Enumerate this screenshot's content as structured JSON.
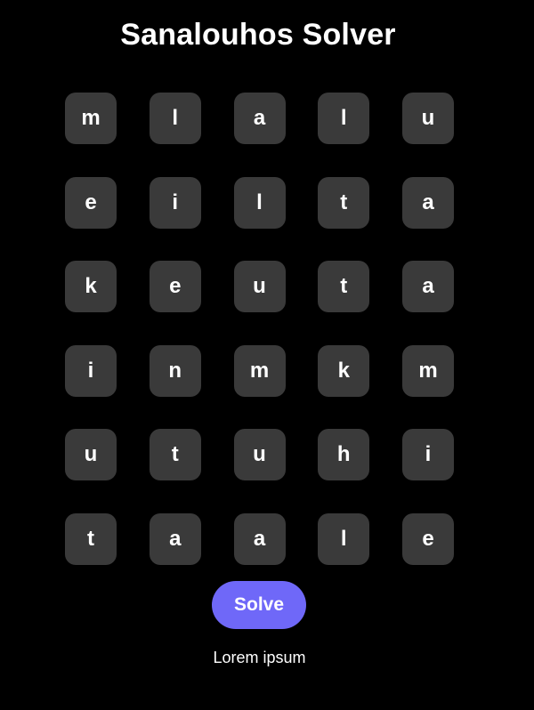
{
  "app": {
    "title": "Sanalouhos Solver"
  },
  "grid": {
    "rows": [
      [
        "m",
        "l",
        "a",
        "l",
        "u"
      ],
      [
        "e",
        "i",
        "l",
        "t",
        "a"
      ],
      [
        "k",
        "e",
        "u",
        "t",
        "a"
      ],
      [
        "i",
        "n",
        "m",
        "k",
        "m"
      ],
      [
        "u",
        "t",
        "u",
        "h",
        "i"
      ],
      [
        "t",
        "a",
        "a",
        "l",
        "e"
      ]
    ]
  },
  "solve_button": {
    "label": "Solve"
  },
  "result": {
    "text": "Lorem ipsum"
  },
  "colors": {
    "background": "#000000",
    "tile": "#3a3a3a",
    "accent": "#6f68f8",
    "text": "#ffffff"
  }
}
